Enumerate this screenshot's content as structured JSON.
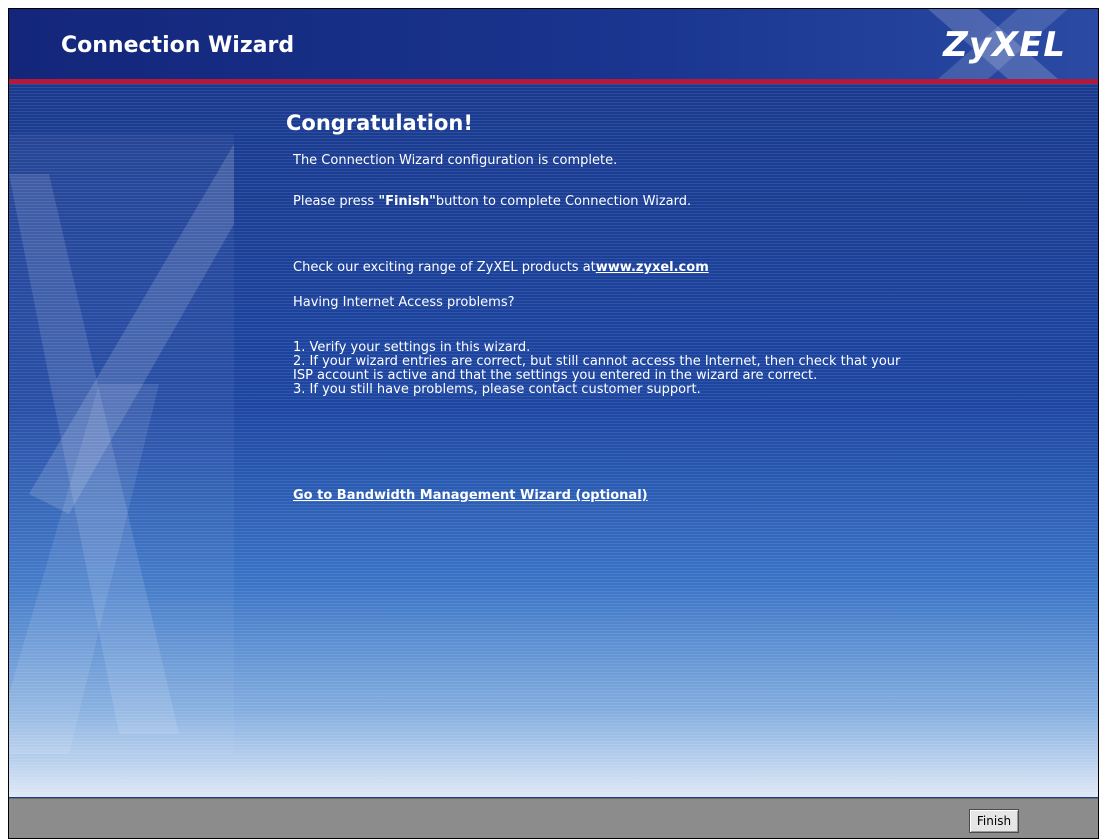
{
  "header": {
    "title": "Connection Wizard",
    "logo_text": "ZyXEL"
  },
  "main": {
    "heading": "Congratulation!",
    "line_complete": "The Connection Wizard configuration is complete.",
    "press_prefix": "Please press ",
    "press_bold": "\"Finish\"",
    "press_suffix": "button to complete Connection Wizard.",
    "check_prefix": "Check our exciting range of ZyXEL products at",
    "check_link": "www.zyxel.com",
    "problems_title": "Having Internet Access problems?",
    "steps": [
      "1. Verify your settings in this wizard.",
      "2. If your wizard entries are correct, but still cannot access the Internet, then check that your",
      "ISP account is active and that the settings you entered in the wizard are correct.",
      "3. If you still have problems, please contact customer support."
    ],
    "bandwidth_link": "Go to Bandwidth Management Wizard (optional)"
  },
  "footer": {
    "finish_label": "Finish"
  },
  "colors": {
    "header_bg": "#13267a",
    "accent_line": "#b11a3c",
    "footer_bg": "#8c8c8c"
  }
}
